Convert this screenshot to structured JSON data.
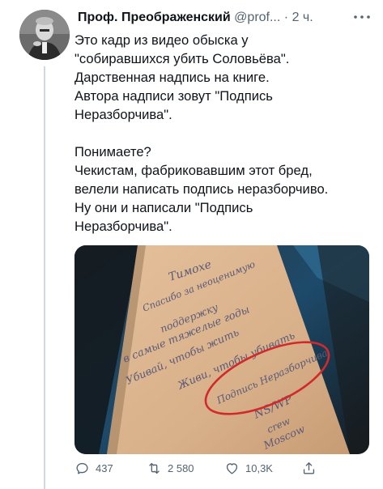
{
  "tweet": {
    "author_name": "Проф. Преображенский",
    "handle": "@prof...",
    "separator": "·",
    "time": "2 ч.",
    "text_lines": [
      "Это кадр из видео обыска у",
      "\"собиравшихся убить Соловьёва\".",
      "Дарственная надпись на книге.",
      "Автора надписи зовут \"Подпись",
      "Неразборчива\".",
      "",
      "Понимаете?",
      "Чекистам, фабриковавшим этот бред,",
      "велели написать подпись неразборчиво.",
      "Ну они и написали \"Подпись",
      "Неразборчива\"."
    ],
    "photo": {
      "handwriting_lines": [
        "Тимохе",
        "Спасибо за неоценимую",
        "поддержку",
        "в самые тяжелые годы",
        "Убивай, чтобы жить",
        "Живи, чтобы убивать",
        "Подпись Неразборчива",
        "NS/WP",
        "crew",
        "Moscow"
      ],
      "circle_color": "#d2292b"
    },
    "stats": {
      "replies": "437",
      "retweets": "2 580",
      "likes": "10,3K"
    },
    "icons": {
      "reply": "reply-icon",
      "retweet": "retweet-icon",
      "like": "heart-icon",
      "share": "share-icon",
      "more": "more-icon"
    }
  }
}
